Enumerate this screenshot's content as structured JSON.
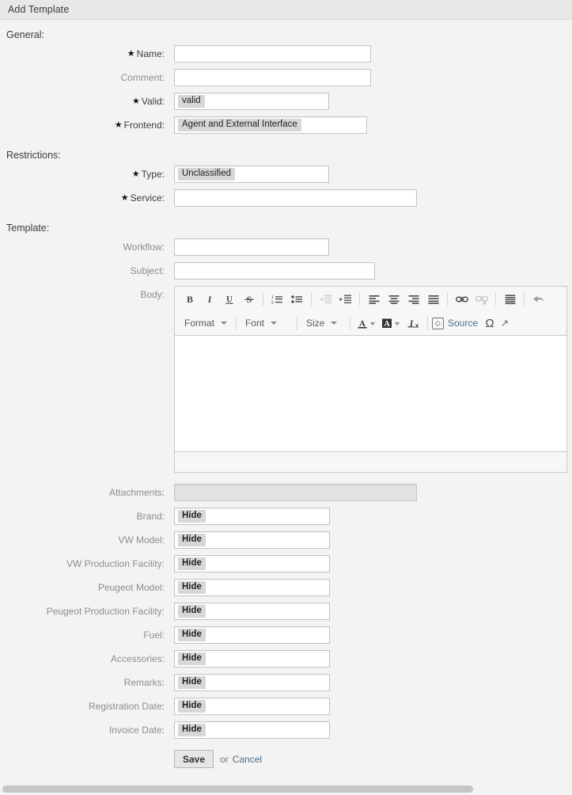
{
  "header": {
    "title": "Add Template"
  },
  "sections": {
    "general": "General:",
    "restrictions": "Restrictions:",
    "template": "Template:"
  },
  "fields": {
    "name": {
      "label": "Name:",
      "required": true,
      "value": ""
    },
    "comment": {
      "label": "Comment:",
      "required": false,
      "value": ""
    },
    "valid": {
      "label": "Valid:",
      "required": true,
      "value": "valid"
    },
    "frontend": {
      "label": "Frontend:",
      "required": true,
      "value": "Agent and External Interface"
    },
    "type": {
      "label": "Type:",
      "required": true,
      "value": "Unclassified"
    },
    "service": {
      "label": "Service:",
      "required": true,
      "value": ""
    },
    "workflow": {
      "label": "Workflow:",
      "required": false,
      "value": ""
    },
    "subject": {
      "label": "Subject:",
      "required": false,
      "value": ""
    },
    "body": {
      "label": "Body:",
      "required": false,
      "value": ""
    },
    "attachments": {
      "label": "Attachments:",
      "required": false,
      "value": ""
    }
  },
  "dynamic_fields": [
    {
      "label": "Brand:",
      "value": "Hide"
    },
    {
      "label": "VW Model:",
      "value": "Hide"
    },
    {
      "label": "VW Production Facility:",
      "value": "Hide"
    },
    {
      "label": "Peugeot Model:",
      "value": "Hide"
    },
    {
      "label": "Peugeot Production Facility:",
      "value": "Hide"
    },
    {
      "label": "Fuel:",
      "value": "Hide"
    },
    {
      "label": "Accessories:",
      "value": "Hide"
    },
    {
      "label": "Remarks:",
      "value": "Hide"
    },
    {
      "label": "Registration Date:",
      "value": "Hide"
    },
    {
      "label": "Invoice Date:",
      "value": "Hide"
    }
  ],
  "editor": {
    "toolbar_row1": [
      {
        "name": "bold-icon",
        "glyph": "B",
        "enabled": true
      },
      {
        "name": "italic-icon",
        "glyph": "I",
        "enabled": true
      },
      {
        "name": "underline-icon",
        "glyph": "U",
        "enabled": true
      },
      {
        "name": "strikethrough-icon",
        "glyph": "S",
        "enabled": true
      },
      {
        "name": "numbered-list-icon",
        "glyph": "",
        "enabled": true
      },
      {
        "name": "bulleted-list-icon",
        "glyph": "",
        "enabled": true
      },
      {
        "name": "decrease-indent-icon",
        "glyph": "",
        "enabled": false
      },
      {
        "name": "increase-indent-icon",
        "glyph": "",
        "enabled": true
      },
      {
        "name": "align-left-icon",
        "glyph": "",
        "enabled": true
      },
      {
        "name": "align-center-icon",
        "glyph": "",
        "enabled": true
      },
      {
        "name": "align-right-icon",
        "glyph": "",
        "enabled": true
      },
      {
        "name": "align-justify-icon",
        "glyph": "",
        "enabled": true
      },
      {
        "name": "link-icon",
        "glyph": "",
        "enabled": true
      },
      {
        "name": "unlink-icon",
        "glyph": "",
        "enabled": false
      },
      {
        "name": "blockquote-icon",
        "glyph": "",
        "enabled": true
      },
      {
        "name": "undo-icon",
        "glyph": "",
        "enabled": true
      }
    ],
    "format_label": "Format",
    "font_label": "Font",
    "size_label": "Size",
    "text_color_label": "A",
    "bg_color_label": "A",
    "remove_format_label": "Ix",
    "source_label": "Source",
    "special_char_label": "Ω",
    "content": ""
  },
  "footer": {
    "save_label": "Save",
    "or_label": "or",
    "cancel_label": "Cancel"
  },
  "colors": {
    "page_bg": "#f3f3f3",
    "header_bg": "#e8e8e8",
    "field_border": "#c4c4c4",
    "token_bg": "#d7d7d7",
    "link": "#4a6d8c",
    "label": "#8d8d8d"
  }
}
